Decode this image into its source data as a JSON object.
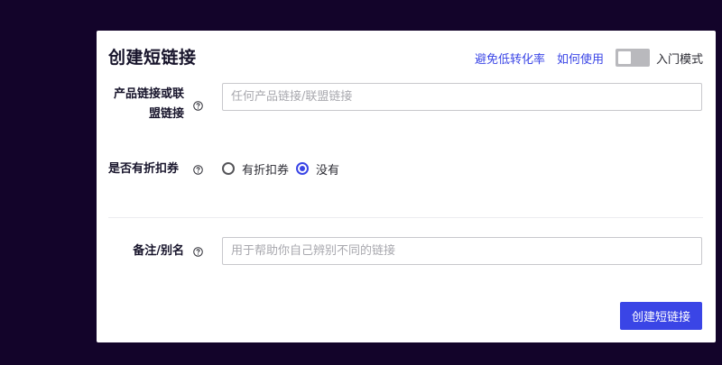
{
  "form": {
    "title": "创建短链接",
    "links": {
      "avoid_conversion_loss": "避免低转化率",
      "how_to_use": "如何使用"
    },
    "mode_toggle": {
      "label": "入门模式",
      "on": false
    },
    "fields": {
      "product_link": {
        "label_line1": "产品链接或联",
        "label_line2": "盟链接",
        "placeholder": "任何产品链接/联盟链接",
        "value": ""
      },
      "has_coupon": {
        "label": "是否有折扣券",
        "options": [
          "有折扣券",
          "没有"
        ],
        "selected": "没有"
      },
      "note": {
        "label": "备注/别名",
        "placeholder": "用于帮助你自己辨别不同的链接",
        "value": ""
      }
    },
    "submit_label": "创建短链接"
  },
  "colors": {
    "background": "#13042a",
    "accent": "#3a45e6",
    "toggle_off": "#b9b9bd"
  },
  "icons": {
    "help": "question-circle-icon"
  }
}
